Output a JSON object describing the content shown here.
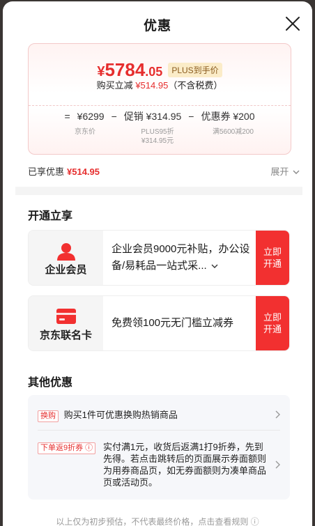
{
  "title": "优惠",
  "price_card": {
    "currency": "¥",
    "final_int": "5784",
    "final_dec": ".05",
    "plus_tag": "PLUS到手价",
    "save_prefix": "购买立减",
    "save_amount": "¥514.95",
    "save_suffix": "（不含税费）",
    "formula": {
      "eq": "=",
      "jd_price": "¥6299",
      "minus1": "−",
      "promo": "促销 ¥314.95",
      "minus2": "−",
      "coupon": "优惠券 ¥200"
    },
    "sub": {
      "jd_price": "京东价",
      "promo_line1": "PLUS95折",
      "promo_line2": "¥314.95元",
      "coupon": "满5600减200"
    }
  },
  "enjoyed": {
    "label": "已享优惠",
    "amount": "¥514.95",
    "expand": "展开"
  },
  "section_open": {
    "title": "开通立享",
    "offers": [
      {
        "label": "企业会员",
        "icon": "person-icon",
        "desc": "企业会员9000元补贴，办公设备/易耗品一站式采...",
        "btn": "立即开通"
      },
      {
        "label": "京东联名卡",
        "icon": "card-icon",
        "desc": "免费领100元无门槛立减券",
        "btn": "立即开通"
      }
    ]
  },
  "section_other": {
    "title": "其他优惠",
    "items": [
      {
        "tag": "换购",
        "text": "购买1件可优惠换购热销商品"
      },
      {
        "tag": "下单返9折券 ⓘ",
        "text": "实付满1元，收货后返满1打9折券，先到先得。若点击跳转后的页面展示券面额则为用券商品页，如无券面额则为凑单商品页或活动页。"
      }
    ]
  },
  "footer": "以上仅为初步预估，不代表最终价格，点击查看规则 ⓘ",
  "colors": {
    "accent": "#e62e2e",
    "button": "#f23030"
  }
}
